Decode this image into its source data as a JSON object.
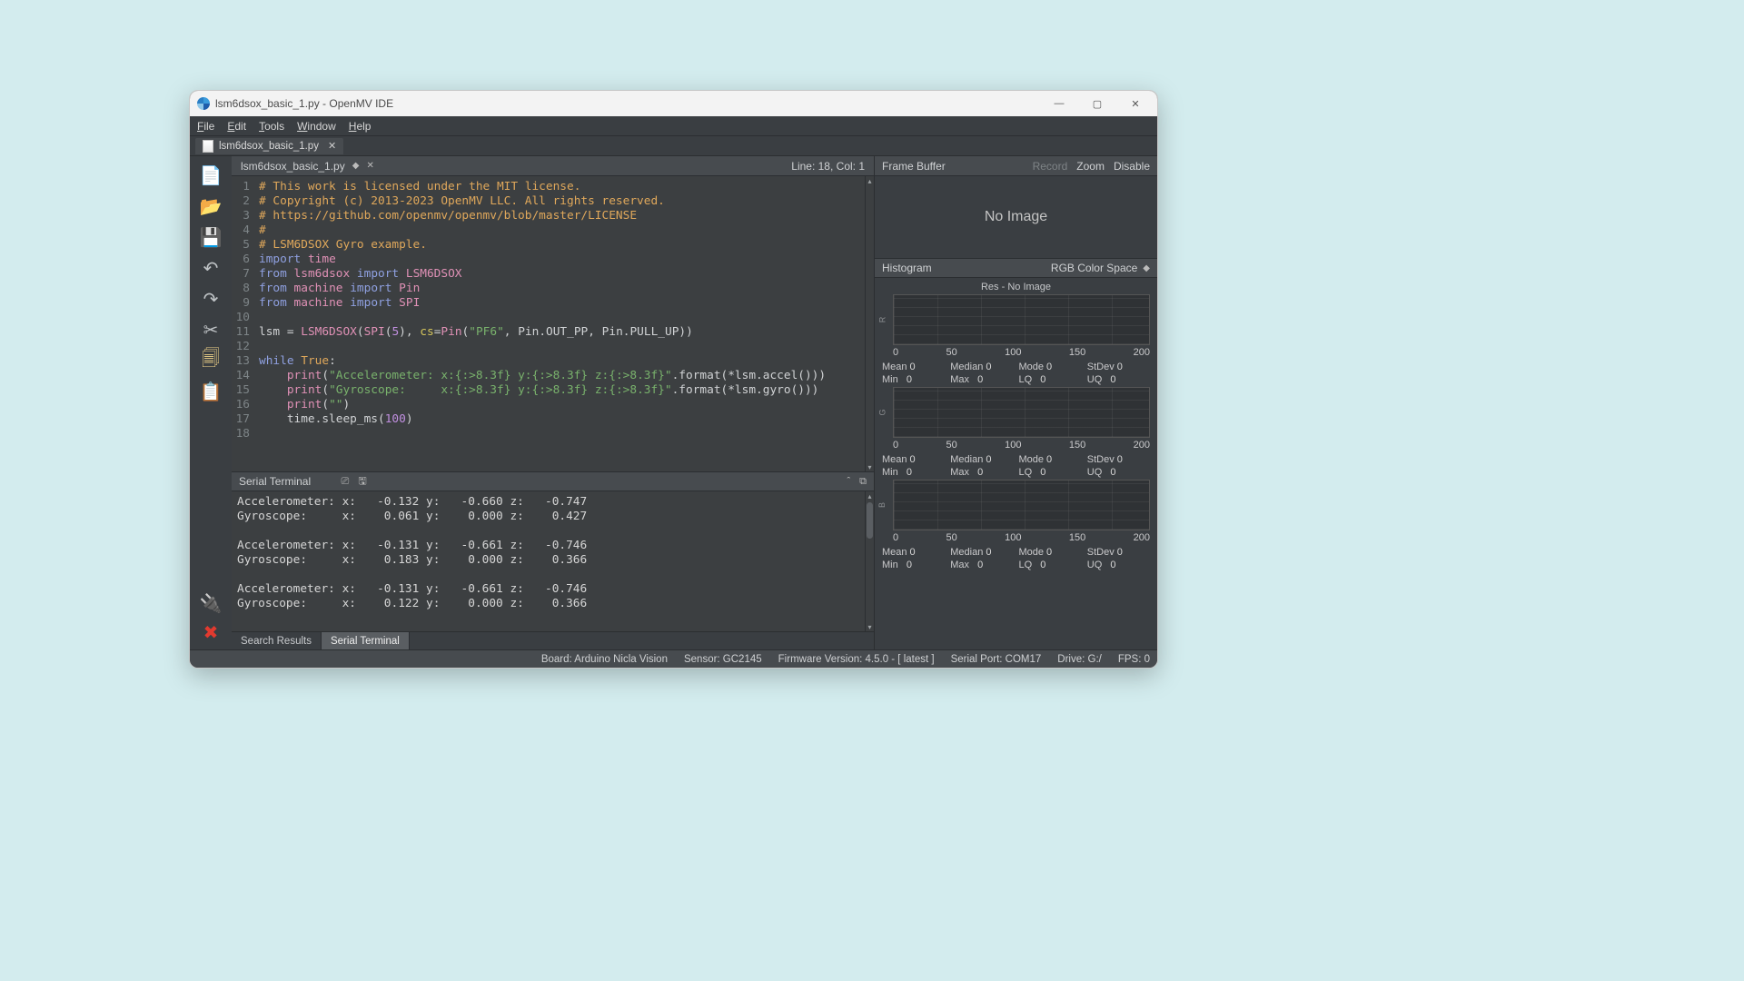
{
  "title": "lsm6dsox_basic_1.py - OpenMV IDE",
  "menu": [
    "File",
    "Edit",
    "Tools",
    "Window",
    "Help"
  ],
  "tab": {
    "name": "lsm6dsox_basic_1.py"
  },
  "toolbar": {
    "new": "new-file",
    "open": "open-file",
    "save": "save-file",
    "undo": "undo",
    "redo": "redo",
    "cut": "cut",
    "copy": "copy",
    "paste": "paste",
    "connect": "connect",
    "stop": "stop"
  },
  "editor": {
    "filename": "lsm6dsox_basic_1.py",
    "cursor": "Line: 18, Col: 1",
    "total_lines": 18
  },
  "serial": {
    "title": "Serial Terminal",
    "lines": [
      "Accelerometer: x:   -0.132 y:   -0.660 z:   -0.747",
      "Gyroscope:     x:    0.061 y:    0.000 z:    0.427",
      "",
      "Accelerometer: x:   -0.131 y:   -0.661 z:   -0.746",
      "Gyroscope:     x:    0.183 y:    0.000 z:    0.366",
      "",
      "Accelerometer: x:   -0.131 y:   -0.661 z:   -0.746",
      "Gyroscope:     x:    0.122 y:    0.000 z:    0.366"
    ]
  },
  "bottom_tabs": {
    "search": "Search Results",
    "serial": "Serial Terminal"
  },
  "right": {
    "fb_title": "Frame Buffer",
    "record": "Record",
    "zoom": "Zoom",
    "disable": "Disable",
    "no_image": "No Image",
    "hist_title": "Histogram",
    "color_space": "RGB Color Space",
    "res": "Res - No Image",
    "ticks": [
      "0",
      "50",
      "100",
      "150",
      "200"
    ],
    "channels": [
      "R",
      "G",
      "B"
    ],
    "stats": {
      "mean": "Mean",
      "median": "Median",
      "mode": "Mode",
      "stdev": "StDev",
      "min": "Min",
      "max": "Max",
      "lq": "LQ",
      "uq": "UQ",
      "zero": "0"
    }
  },
  "status": {
    "board": "Board: Arduino Nicla Vision",
    "sensor": "Sensor: GC2145",
    "fw": "Firmware Version: 4.5.0 - [ latest ]",
    "port": "Serial Port: COM17",
    "drive": "Drive: G:/",
    "fps": "FPS: 0"
  }
}
